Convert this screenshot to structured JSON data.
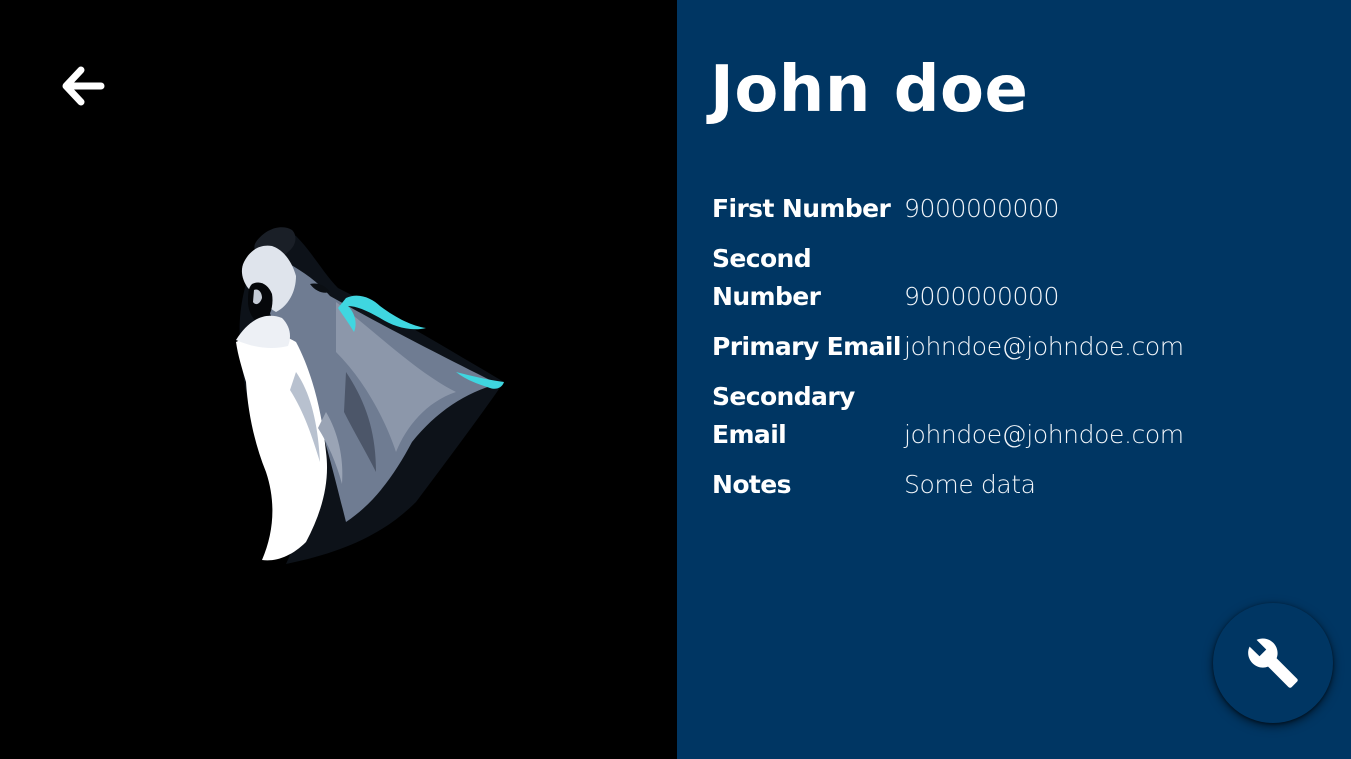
{
  "navigation": {
    "back_icon": "arrow-left-icon"
  },
  "avatar": {
    "icon": "howling-wolf-logo",
    "accent_color": "#3fd6e0"
  },
  "contact": {
    "name": "John doe",
    "fields": [
      {
        "label": "First Number",
        "value": "9000000000"
      },
      {
        "label": "Second Number",
        "value": "9000000000"
      },
      {
        "label": "Primary Email",
        "value": "johndoe@johndoe.com"
      },
      {
        "label": "Secondary Email",
        "value": "johndoe@johndoe.com"
      },
      {
        "label": "Notes",
        "value": "Some data"
      }
    ]
  },
  "actions": {
    "edit_icon": "wrench-icon"
  },
  "colors": {
    "left_background": "#000000",
    "right_background": "#003663",
    "text": "#ffffff"
  }
}
